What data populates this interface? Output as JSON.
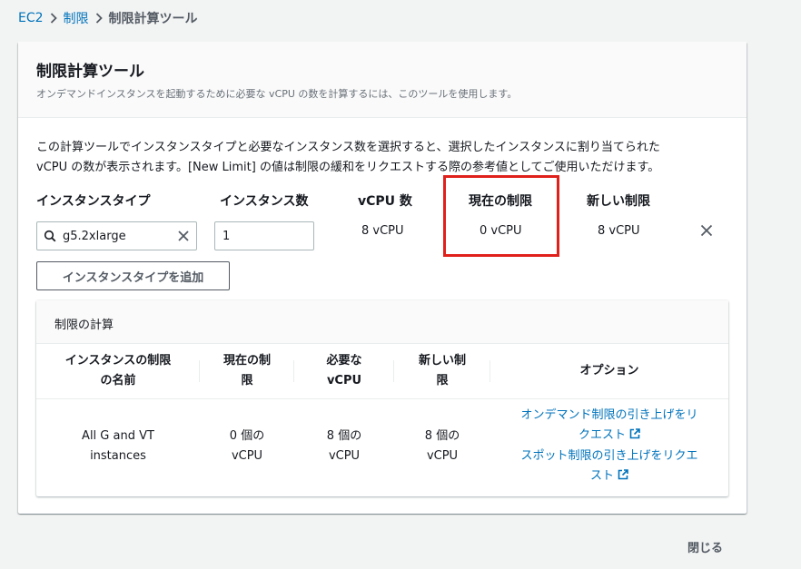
{
  "breadcrumb": {
    "items": [
      "EC2",
      "制限",
      "制限計算ツール"
    ]
  },
  "panel": {
    "title": "制限計算ツール",
    "description": "オンデマンドインスタンスを起動するために必要な vCPU の数を計算するには、このツールを使用します。"
  },
  "intro": {
    "line1": "この計算ツールでインスタンスタイプと必要なインスタンス数を選択すると、選択したインスタンスに割り当てられた",
    "line2": "vCPU の数が表示されます。[New Limit] の値は制限の緩和をリクエストする際の参考値としてご使用いただけます。"
  },
  "columns": {
    "instance_type": "インスタンスタイプ",
    "instance_count": "インスタンス数",
    "vcpu_count": "vCPU 数",
    "current_limit": "現在の制限",
    "new_limit": "新しい制限"
  },
  "row": {
    "instance_type_value": "g5.2xlarge",
    "instance_count_value": "1",
    "vcpu": "8 vCPU",
    "current": "0 vCPU",
    "new": "8 vCPU"
  },
  "add_button": "インスタンスタイプを追加",
  "calc": {
    "title": "制限の計算",
    "headers": {
      "name_l1": "インスタンスの制限",
      "name_l2": "の名前",
      "current_l1": "現在の制",
      "current_l2": "限",
      "required_l1": "必要な",
      "required_l2": "vCPU",
      "new_l1": "新しい制",
      "new_l2": "限",
      "options": "オプション"
    },
    "row": {
      "name_l1": "All G and VT",
      "name_l2": "instances",
      "current_l1": "0 個の",
      "current_l2": "vCPU",
      "required_l1": "8 個の",
      "required_l2": "vCPU",
      "new_l1": "8 個の",
      "new_l2": "vCPU",
      "ondemand_l1": "オンデマンド制限の引き上げをリ",
      "ondemand_l2": "クエスト",
      "spot_l1": "スポット制限の引き上げをリクエ",
      "spot_l2": "スト"
    }
  },
  "close_button": "閉じる",
  "colors": {
    "link": "#0073bb",
    "highlight": "#e0201b"
  }
}
